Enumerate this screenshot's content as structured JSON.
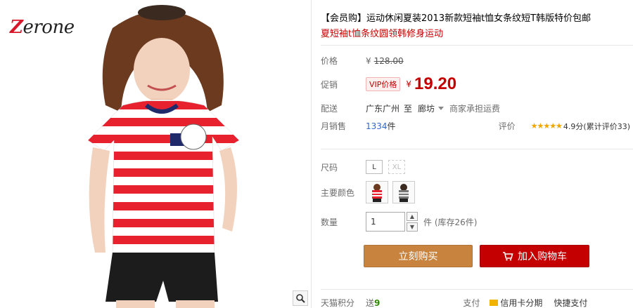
{
  "brand": {
    "logo_text": "Zerone"
  },
  "product": {
    "title_line1": "【会员购】运动休闲夏装2013新款短袖t恤女条纹短T韩版特价包邮",
    "title_line2": "夏短袖t恤条纹圆领韩修身运动"
  },
  "price": {
    "label": "价格",
    "currency": "¥",
    "original": "128.00"
  },
  "promo": {
    "label": "促销",
    "badge": "VIP价格",
    "currency": "¥",
    "value": "19.20"
  },
  "shipping": {
    "label": "配送",
    "from": "广东广州",
    "to_word": "至",
    "destination": "廊坊",
    "note": "商家承担运费"
  },
  "sales": {
    "label": "月销售",
    "count": "1334",
    "unit": "件",
    "rating_label": "评价",
    "stars": "★★★★★",
    "rating_text": "4.9分(累计评价33)"
  },
  "size": {
    "label": "尺码",
    "options": [
      "L",
      "XL"
    ]
  },
  "color": {
    "label": "主要颜色"
  },
  "quantity": {
    "label": "数量",
    "value": "1",
    "stock_text": "件 (库存26件)"
  },
  "actions": {
    "buy_now": "立刻购买",
    "add_cart": "加入购物车"
  },
  "bottom": {
    "points_label": "天猫积分",
    "points_send": "送",
    "points_value": "9",
    "pay_label": "支付",
    "credit_text": "信用卡分期",
    "quick_pay": "快捷支付"
  },
  "colors": {
    "accent_red": "#c40000",
    "buy_button": "#c8843f",
    "cart_button": "#c40000",
    "link_blue": "#3366cc"
  }
}
